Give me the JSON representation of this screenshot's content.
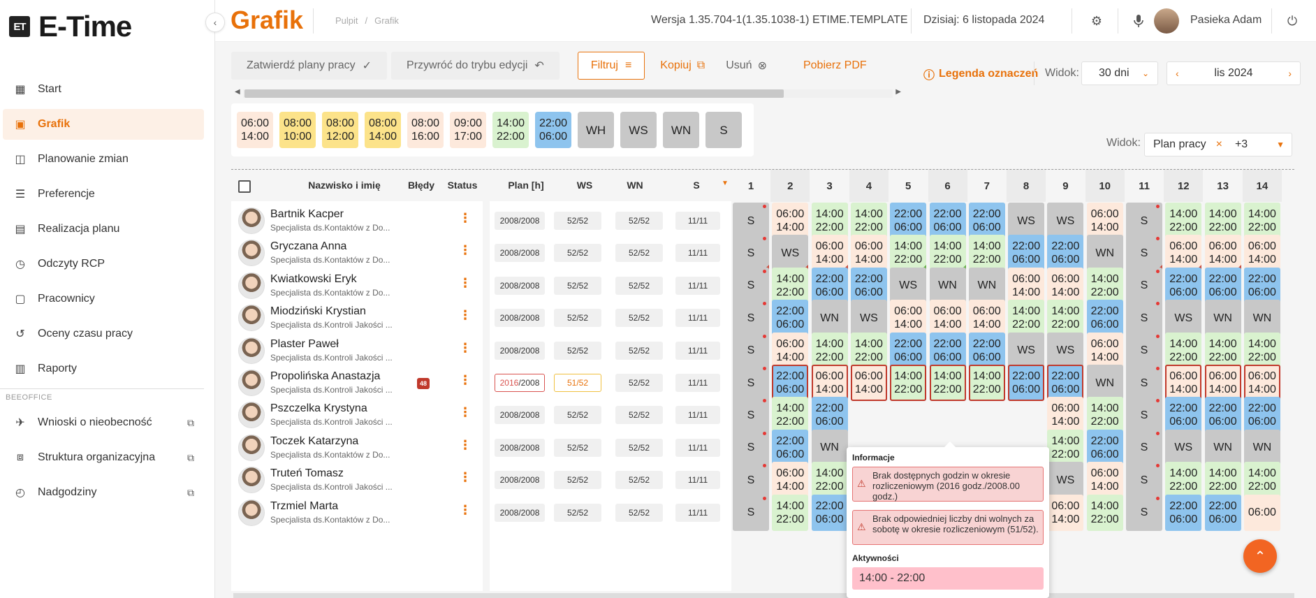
{
  "sidebar": {
    "logo_box": "ET",
    "logo_text": "E-Time",
    "items": [
      {
        "label": "Start",
        "icon": "building-icon"
      },
      {
        "label": "Grafik",
        "icon": "calendar-icon",
        "active": true
      },
      {
        "label": "Planowanie zmian",
        "icon": "layout-icon"
      },
      {
        "label": "Preferencje",
        "icon": "sliders-icon"
      },
      {
        "label": "Realizacja planu",
        "icon": "calendar-list-icon"
      },
      {
        "label": "Odczyty RCP",
        "icon": "clock-check-icon"
      },
      {
        "label": "Pracownicy",
        "icon": "id-badge-icon"
      },
      {
        "label": "Oceny czasu pracy",
        "icon": "history-icon"
      },
      {
        "label": "Raporty",
        "icon": "report-icon"
      }
    ],
    "section": "BEEOFFICE",
    "external": [
      {
        "label": "Wnioski o nieobecność",
        "icon": "plane-icon"
      },
      {
        "label": "Struktura organizacyjna",
        "icon": "org-chart-icon"
      },
      {
        "label": "Nadgodziny",
        "icon": "overtime-icon"
      }
    ]
  },
  "topbar": {
    "title": "Grafik",
    "breadcrumb": [
      "Pulpit",
      "/",
      "Grafik"
    ],
    "version": "Wersja 1.35.704-1(1.35.1038-1) ETIME.TEMPLATE",
    "today": "Dzisiaj: 6 listopada 2024",
    "user": "Pasieka Adam"
  },
  "toolbar": {
    "approve": "Zatwierdź plany pracy",
    "restore": "Przywróć do trybu edycji",
    "filter": "Filtruj",
    "copy": "Kopiuj",
    "delete": "Usuń",
    "pdf": "Pobierz PDF",
    "legend": "Legenda oznaczeń",
    "view_label": "Widok:",
    "view_value": "30 dni",
    "month": "lis 2024",
    "view2_label": "Widok:",
    "view2_value": "Plan pracy",
    "view2_more": "+3"
  },
  "palette": [
    {
      "a": "06:00",
      "b": "14:00",
      "color": "#fde9dc"
    },
    {
      "a": "08:00",
      "b": "10:00",
      "color": "#fce38a"
    },
    {
      "a": "08:00",
      "b": "12:00",
      "color": "#fce38a"
    },
    {
      "a": "08:00",
      "b": "14:00",
      "color": "#fce38a"
    },
    {
      "a": "08:00",
      "b": "16:00",
      "color": "#fde9dc"
    },
    {
      "a": "09:00",
      "b": "17:00",
      "color": "#fde9dc"
    },
    {
      "a": "14:00",
      "b": "22:00",
      "color": "#d9f2cf"
    },
    {
      "a": "22:00",
      "b": "06:00",
      "color": "#8ec4ee"
    },
    {
      "code": "WH"
    },
    {
      "code": "WS"
    },
    {
      "code": "WN"
    },
    {
      "code": "S"
    }
  ],
  "grid": {
    "headers": {
      "name": "Nazwisko i imię",
      "errors": "Błędy",
      "status": "Status",
      "plan": "Plan [h]",
      "ws": "WS",
      "wn": "WN",
      "s": "S"
    },
    "days": [
      "1",
      "2",
      "3",
      "4",
      "5",
      "6",
      "7",
      "8",
      "9",
      "10",
      "11",
      "12",
      "13",
      "14"
    ],
    "rows": [
      {
        "name": "Bartnik Kacper",
        "role": "Specjalista ds.Kontaktów z Do...",
        "plan_ok": "2008",
        "plan_total": "2008",
        "ws": "52/52",
        "wn": "52/52",
        "s": "11/11",
        "cells": [
          "S",
          "06:00|14:00",
          "14:00|22:00",
          "14:00|22:00",
          "22:00|06:00",
          "22:00|06:00",
          "22:00|06:00",
          "WS",
          "WS",
          "06:00|14:00",
          "S",
          "14:00|22:00",
          "14:00|22:00",
          "14:00|22:00"
        ]
      },
      {
        "name": "Gryczana Anna",
        "role": "Specjalista ds.Kontaktów z Do...",
        "plan_ok": "2008",
        "plan_total": "2008",
        "ws": "52/52",
        "wn": "52/52",
        "s": "11/11",
        "cells": [
          "S",
          "WS",
          "06:00|14:00",
          "06:00|14:00",
          "14:00|22:00",
          "14:00|22:00",
          "14:00|22:00",
          "22:00|06:00",
          "22:00|06:00",
          "WN",
          "S",
          "06:00|14:00",
          "06:00|14:00",
          "06:00|14:00"
        ]
      },
      {
        "name": "Kwiatkowski Eryk",
        "role": "Specjalista ds.Kontaktów z Do...",
        "plan_ok": "2008",
        "plan_total": "2008",
        "ws": "52/52",
        "wn": "52/52",
        "s": "11/11",
        "cells": [
          "S",
          "14:00|22:00",
          "22:00|06:00",
          "22:00|06:00",
          "WS",
          "WN",
          "WN",
          "06:00|14:00",
          "06:00|14:00",
          "14:00|22:00",
          "S",
          "22:00|06:00",
          "22:00|06:00",
          "22:00|06:00"
        ]
      },
      {
        "name": "Miodziński Krystian",
        "role": "Specjalista ds.Kontroli Jakości ...",
        "plan_ok": "2008",
        "plan_total": "2008",
        "ws": "52/52",
        "wn": "52/52",
        "s": "11/11",
        "cells": [
          "S",
          "22:00|06:00",
          "WN",
          "WS",
          "06:00|14:00",
          "06:00|14:00",
          "06:00|14:00",
          "14:00|22:00",
          "14:00|22:00",
          "22:00|06:00",
          "S",
          "WS",
          "WN",
          "WN"
        ]
      },
      {
        "name": "Plaster Paweł",
        "role": "Specjalista ds.Kontroli Jakości ...",
        "plan_ok": "2008",
        "plan_total": "2008",
        "ws": "52/52",
        "wn": "52/52",
        "s": "11/11",
        "cells": [
          "S",
          "06:00|14:00",
          "14:00|22:00",
          "14:00|22:00",
          "22:00|06:00",
          "22:00|06:00",
          "22:00|06:00",
          "WS",
          "WS",
          "06:00|14:00",
          "S",
          "14:00|22:00",
          "14:00|22:00",
          "14:00|22:00"
        ]
      },
      {
        "name": "Propolińska Anastazja",
        "role": "Specjalista ds.Kontroli Jakości ...",
        "errors": "48",
        "plan_ok": "2016",
        "plan_total": "2008",
        "plan_err": true,
        "ws": "51/52",
        "ws_warn": true,
        "wn": "52/52",
        "s": "11/11",
        "cells": [
          "S",
          "22:00|06:00",
          "06:00|14:00",
          "06:00|14:00",
          "14:00|22:00",
          "14:00|22:00",
          "14:00|22:00",
          "22:00|06:00",
          "22:00|06:00",
          "WN",
          "S",
          "06:00|14:00",
          "06:00|14:00",
          "06:00|14:00"
        ]
      },
      {
        "name": "Pszczelka Krystyna",
        "role": "Specjalista ds.Kontroli Jakości ...",
        "plan_ok": "2008",
        "plan_total": "2008",
        "ws": "52/52",
        "wn": "52/52",
        "s": "11/11",
        "cells": [
          "S",
          "14:00|22:00",
          "22:00|06:00",
          "",
          "",
          "",
          "",
          "",
          "06:00|14:00",
          "14:00|22:00",
          "S",
          "22:00|06:00",
          "22:00|06:00",
          "22:00|06:00"
        ]
      },
      {
        "name": "Toczek Katarzyna",
        "role": "Specjalista ds.Kontaktów z Do...",
        "plan_ok": "2008",
        "plan_total": "2008",
        "ws": "52/52",
        "wn": "52/52",
        "s": "11/11",
        "cells": [
          "S",
          "22:00|06:00",
          "WN",
          "",
          "",
          "",
          "",
          "",
          "14:00|22:00",
          "22:00|06:00",
          "S",
          "WS",
          "WN",
          "WN"
        ]
      },
      {
        "name": "Truteń Tomasz",
        "role": "Specjalista ds.Kontroli Jakości ...",
        "plan_ok": "2008",
        "plan_total": "2008",
        "ws": "52/52",
        "wn": "52/52",
        "s": "11/11",
        "cells": [
          "S",
          "06:00|14:00",
          "14:00|22:00",
          "",
          "",
          "",
          "",
          "",
          "WS",
          "06:00|14:00",
          "S",
          "14:00|22:00",
          "14:00|22:00",
          "14:00|22:00"
        ]
      },
      {
        "name": "Trzmiel Marta",
        "role": "Specjalista ds.Kontaktów z Do...",
        "plan_ok": "2008",
        "plan_total": "2008",
        "ws": "52/52",
        "wn": "52/52",
        "s": "11/11",
        "cells": [
          "S",
          "14:00|22:00",
          "22:00|06:00",
          "",
          "",
          "",
          "",
          "",
          "06:00|14:00",
          "14:00|22:00",
          "S",
          "22:00|06:00",
          "22:00|06:00",
          "06:00"
        ]
      }
    ]
  },
  "tooltip": {
    "info_title": "Informacje",
    "alert1": "Brak dostępnych godzin w okresie rozliczeniowym (2016 godz./2008.00 godz.)",
    "alert2": "Brak odpowiedniej liczby dni wolnych za sobotę w okresie rozliczeniowym (51/52).",
    "activity_title": "Aktywności",
    "activity": "14:00 - 22:00"
  },
  "colors": {
    "accent": "#e8710a",
    "morning": "#fde9dc",
    "short": "#fce38a",
    "afternoon": "#d9f2cf",
    "night": "#8ec4ee",
    "off": "#c8c8c8",
    "error": "#c0392b"
  }
}
